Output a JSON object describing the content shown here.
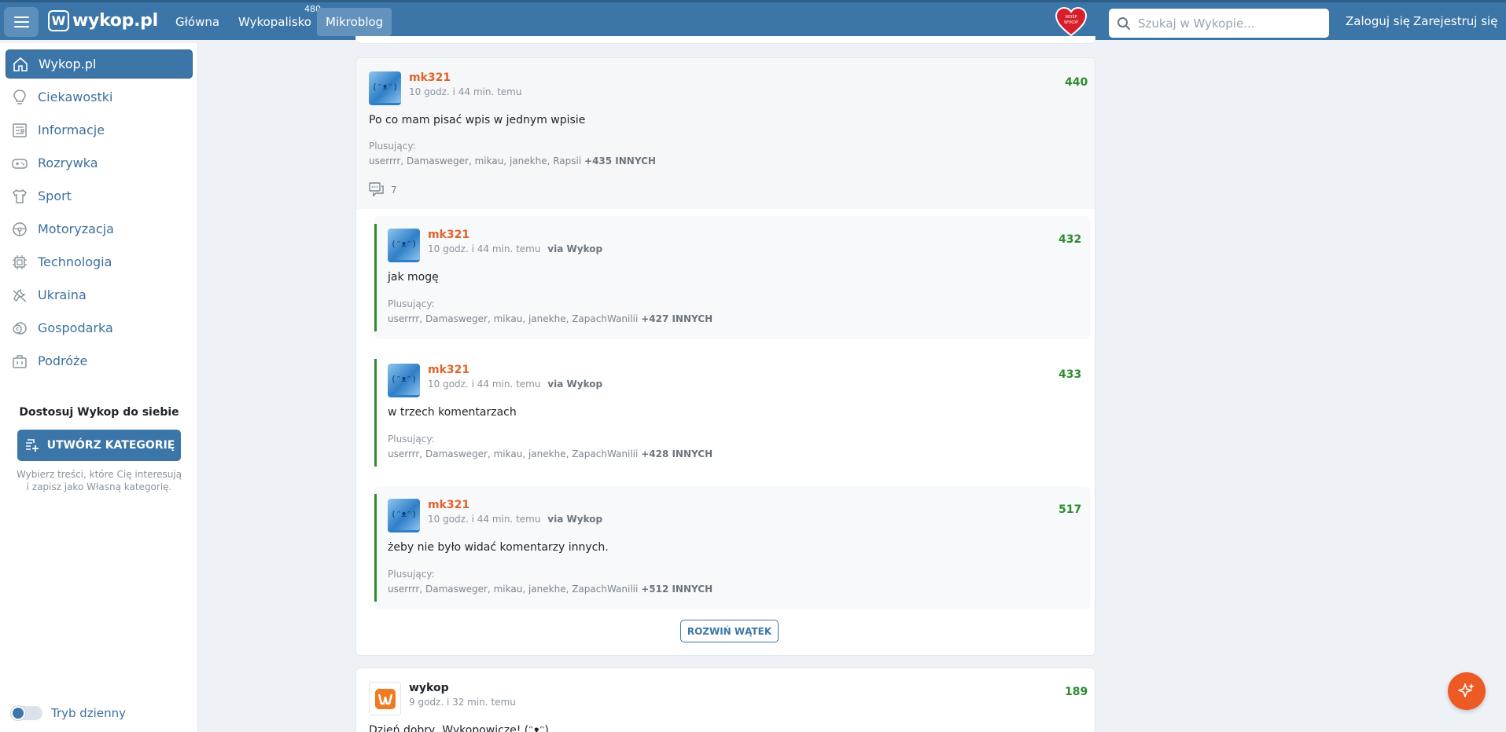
{
  "topbar": {
    "logo": "wykop.pl",
    "nav": [
      {
        "label": "Główna"
      },
      {
        "label": "Wykopalisko",
        "badge": "480"
      },
      {
        "label": "Mikroblog",
        "active": true
      }
    ],
    "search_placeholder": "Szukaj w Wykopie...",
    "login": "Zaloguj się",
    "register": "Zarejestruj się"
  },
  "sidebar": {
    "items": [
      {
        "label": "Wykop.pl",
        "icon": "home-icon",
        "active": true
      },
      {
        "label": "Ciekawostki",
        "icon": "lightbulb-icon"
      },
      {
        "label": "Informacje",
        "icon": "newspaper-icon"
      },
      {
        "label": "Rozrywka",
        "icon": "gamepad-icon"
      },
      {
        "label": "Sport",
        "icon": "shirt-icon"
      },
      {
        "label": "Motoryzacja",
        "icon": "steering-wheel-icon"
      },
      {
        "label": "Technologia",
        "icon": "chip-icon"
      },
      {
        "label": "Ukraina",
        "icon": "ukraine-icon"
      },
      {
        "label": "Gospodarka",
        "icon": "coins-icon"
      },
      {
        "label": "Podróże",
        "icon": "suitcase-icon"
      }
    ],
    "customize_title": "Dostosuj Wykop do siebie",
    "create_button": "UTWÓRZ KATEGORIĘ",
    "customize_desc": "Wybierz treści, które Cię interesują i zapisz jako Własną kategorię.",
    "theme_toggle": "Tryb dzienny"
  },
  "main_entry": {
    "author": "mk321",
    "time": "10 godz. i 44 min. temu",
    "score": "440",
    "content": "Po co mam pisać wpis w jednym wpisie",
    "voters_label": "Plusujący:",
    "voters": "userrrr, Damasweger, mikau, janekhe, Rapsii",
    "voters_more": "+435 INNYCH",
    "comments_count": "7"
  },
  "replies": [
    {
      "author": "mk321",
      "time": "10 godz. i 44 min. temu",
      "via": "via Wykop",
      "score": "432",
      "content": "jak mogę",
      "voters_label": "Plusujący:",
      "voters": "userrrr, Damasweger, mikau, janekhe, ZapachWanilii",
      "voters_more": "+427 INNYCH"
    },
    {
      "author": "mk321",
      "time": "10 godz. i 44 min. temu",
      "via": "via Wykop",
      "score": "433",
      "content": "w trzech komentarzach",
      "voters_label": "Plusujący:",
      "voters": "userrrr, Damasweger, mikau, janekhe, ZapachWanilii",
      "voters_more": "+428 INNYCH"
    },
    {
      "author": "mk321",
      "time": "10 godz. i 44 min. temu",
      "via": "via Wykop",
      "score": "517",
      "content": "żeby nie było widać komentarzy innych.",
      "voters_label": "Plusujący:",
      "voters": "userrrr, Damasweger, mikau, janekhe, ZapachWanilii",
      "voters_more": "+512 INNYCH"
    }
  ],
  "expand_button": "ROZWIŃ WĄTEK",
  "second_entry": {
    "author": "wykop",
    "time": "9 godz. i 32 min. temu",
    "score": "189",
    "content": "Dzień dobry, Wykopowicze! (ᵔᴥᵔ)"
  },
  "avatar_face": "(ᵔᴥᵔ)",
  "colors": {
    "brand": "#3c76a8",
    "accent": "#e0622a",
    "score": "#2e8b2e",
    "fab": "#ee5a24"
  }
}
